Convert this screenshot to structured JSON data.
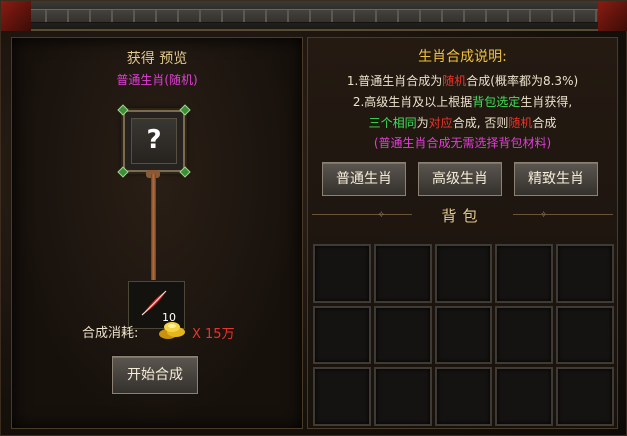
{
  "preview": {
    "title": "获得 预览",
    "subtitle": "普通生肖(随机)",
    "unknown_symbol": "?"
  },
  "material": {
    "count": "10",
    "icon": "red-feather-icon"
  },
  "cost": {
    "label": "合成消耗:",
    "value": "X 15万",
    "icon": "gold-coins-icon"
  },
  "start_button": "开始合成",
  "description": {
    "title": "生肖合成说明:",
    "line1": {
      "a": "1.普通生肖合成为",
      "b": "随机",
      "c": "合成(概率都为8.3%)"
    },
    "line2": {
      "a": "2.高级生肖及以上根据",
      "b": "背包选定",
      "c": "生肖获得,"
    },
    "line3": {
      "a": "三个相同",
      "b": "为",
      "c": "对应",
      "d": "合成, 否则",
      "e": "随机",
      "f": "合成"
    },
    "line4": "(普通生肖合成无需选择背包材料)"
  },
  "tabs": [
    "普通生肖",
    "高级生肖",
    "精致生肖"
  ],
  "bag": {
    "title": "背包",
    "rows": 3,
    "cols": 5
  },
  "colors": {
    "gold_title": "#f0c23c",
    "red": "#ef3328",
    "green": "#3ee05a",
    "purple": "#e23dd8"
  }
}
